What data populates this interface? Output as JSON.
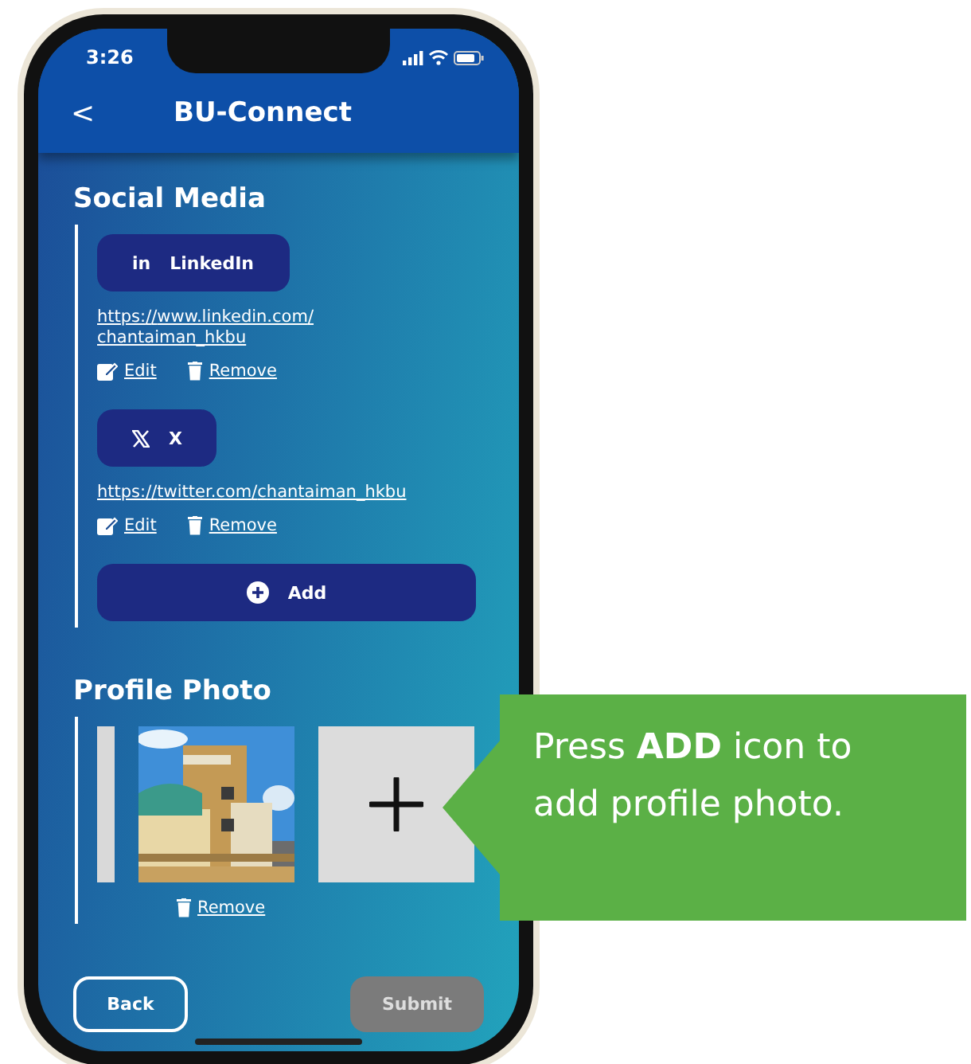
{
  "status_bar": {
    "time": "3:26"
  },
  "header": {
    "back": "<",
    "title": "BU-Connect"
  },
  "social_media": {
    "title": "Social Media",
    "accounts": [
      {
        "kind": "linkedin",
        "icon_text": "in",
        "label": "LinkedIn",
        "url": "https://www.linkedin.com/chantaiman_hkbu",
        "edit": "Edit",
        "remove": "Remove"
      },
      {
        "kind": "x",
        "label": "X",
        "url": "https://twitter.com/chantaiman_hkbu",
        "edit": "Edit",
        "remove": "Remove"
      }
    ],
    "add_button": "Add"
  },
  "profile_photo": {
    "title": "Profile Photo",
    "photos": [
      {
        "kind": "partial"
      },
      {
        "kind": "picture"
      },
      {
        "kind": "add"
      }
    ],
    "remove": "Remove"
  },
  "footer": {
    "back": {
      "label": "Back",
      "disabled": false
    },
    "submit": {
      "label": "Submit",
      "disabled": true
    }
  },
  "callout": {
    "text": "Press **ADD** icon to add profile photo."
  }
}
